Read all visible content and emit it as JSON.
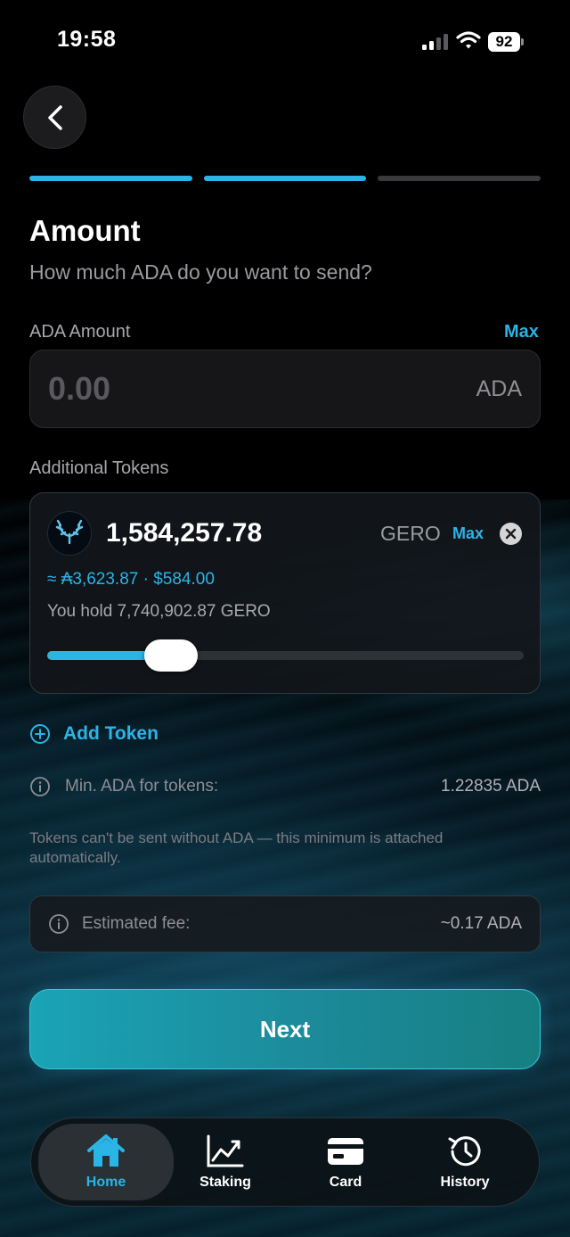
{
  "status_bar": {
    "time": "19:58",
    "battery": "92"
  },
  "progress": {
    "steps_total": 3,
    "steps_done": 2
  },
  "header": {
    "title": "Amount",
    "subtitle": "How much ADA do you want to send?"
  },
  "ada_amount": {
    "label": "ADA Amount",
    "max_label": "Max",
    "value": "0.00",
    "unit": "ADA"
  },
  "additional_tokens": {
    "label": "Additional Tokens",
    "token": {
      "amount": "1,584,257.78",
      "symbol": "GERO",
      "max_label": "Max",
      "value_line": "≈ ₳3,623.87 · $584.00",
      "hold_line": "You hold 7,740,902.87 GERO",
      "slider_fraction": 0.2
    }
  },
  "add_token_label": "Add Token",
  "min_ada": {
    "label": "Min. ADA for tokens:",
    "value": "1.22835 ADA"
  },
  "note": "Tokens can't be sent without ADA — this minimum is attached automatically.",
  "fee": {
    "label": "Estimated fee:",
    "value": "~0.17 ADA"
  },
  "next_label": "Next",
  "tabs": [
    {
      "label": "Home",
      "icon": "home-icon",
      "active": true
    },
    {
      "label": "Staking",
      "icon": "chart-icon",
      "active": false
    },
    {
      "label": "Card",
      "icon": "card-icon",
      "active": false
    },
    {
      "label": "History",
      "icon": "history-icon",
      "active": false
    }
  ],
  "colors": {
    "accent": "#2bb4e6",
    "button": "#1a9aae",
    "background": "#000000"
  }
}
